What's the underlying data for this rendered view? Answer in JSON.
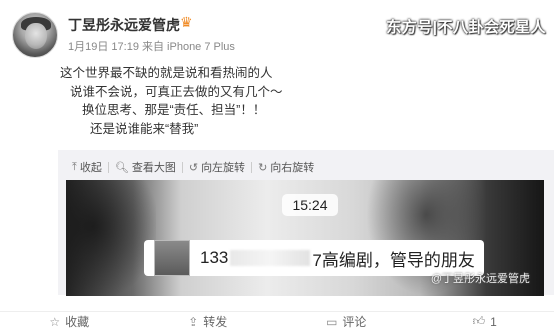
{
  "header": {
    "username": "丁昱彤永远爱管虎",
    "meta": "1月19日 17:19 来自 iPhone 7 Plus",
    "watermark": "东方号|不八卦会死星人"
  },
  "post": {
    "lines": [
      "这个世界最不缺的就是说和看热闹的人",
      "说谁不会说，可真正去做的又有几个～",
      "换位思考、那是“责任、担当”！！",
      "还是说谁能来“替我”"
    ]
  },
  "toolbar": {
    "collapse": "收起",
    "view_large": "查看大图",
    "rotate_left": "向左旋转",
    "rotate_right": "向右旋转"
  },
  "media": {
    "time": "15:24",
    "message_prefix": "133",
    "message_suffix": "7高编剧，管导的朋友",
    "watermark": "@丁昱彤永远爱管虎"
  },
  "footer": {
    "favorite": "收藏",
    "repost": "转发",
    "comment": "评论",
    "like": "1"
  },
  "icons": {
    "badge": "crown-icon",
    "collapse": "arrow-up-icon",
    "view_large": "search-icon",
    "rotate_left": "rotate-left-icon",
    "rotate_right": "rotate-right-icon",
    "favorite": "star-icon",
    "repost": "repost-icon",
    "comment": "comment-icon",
    "like": "thumbs-up-icon"
  }
}
